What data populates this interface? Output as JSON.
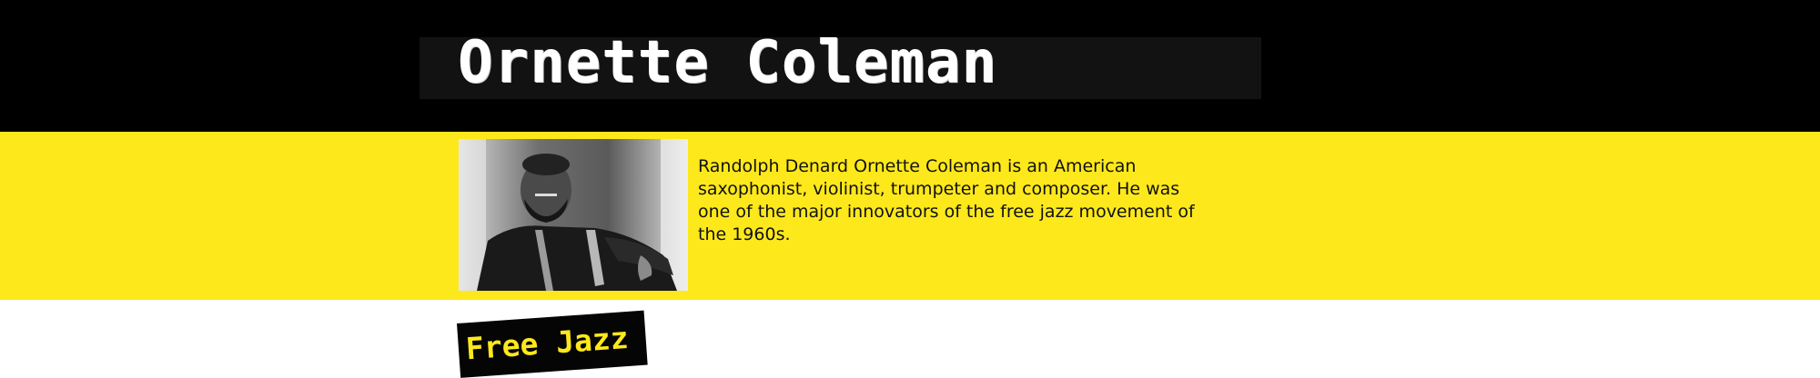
{
  "header": {
    "title": "Ornette Coleman"
  },
  "bio": {
    "photo_icon": "portrait-photo-icon",
    "text": "Randolph Denard Ornette Coleman is an American saxophonist, violinist, trumpeter and composer. He was one of the major innovators of the free jazz movement of the 1960s."
  },
  "section": {
    "tag": "Free Jazz"
  },
  "colors": {
    "header_background": "#000000",
    "accent_yellow": "#fde81c",
    "page_background": "#ffffff"
  }
}
